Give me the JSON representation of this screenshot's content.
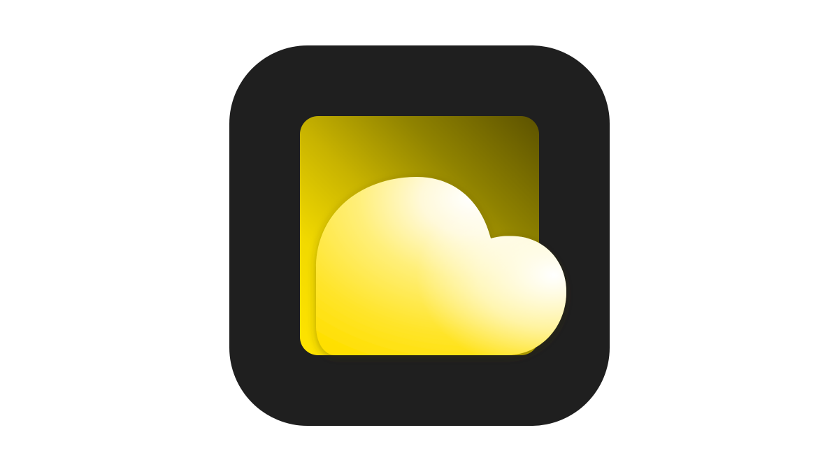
{
  "app_icon": {
    "icon_name": "weather-cloud-icon",
    "colors": {
      "frame": "#1f1f1f",
      "tile_dark": "#5c5200",
      "tile_light": "#ffe400",
      "cloud_highlight": "#ffffff",
      "cloud_base": "#ffe000",
      "background": "#ffffff"
    }
  }
}
